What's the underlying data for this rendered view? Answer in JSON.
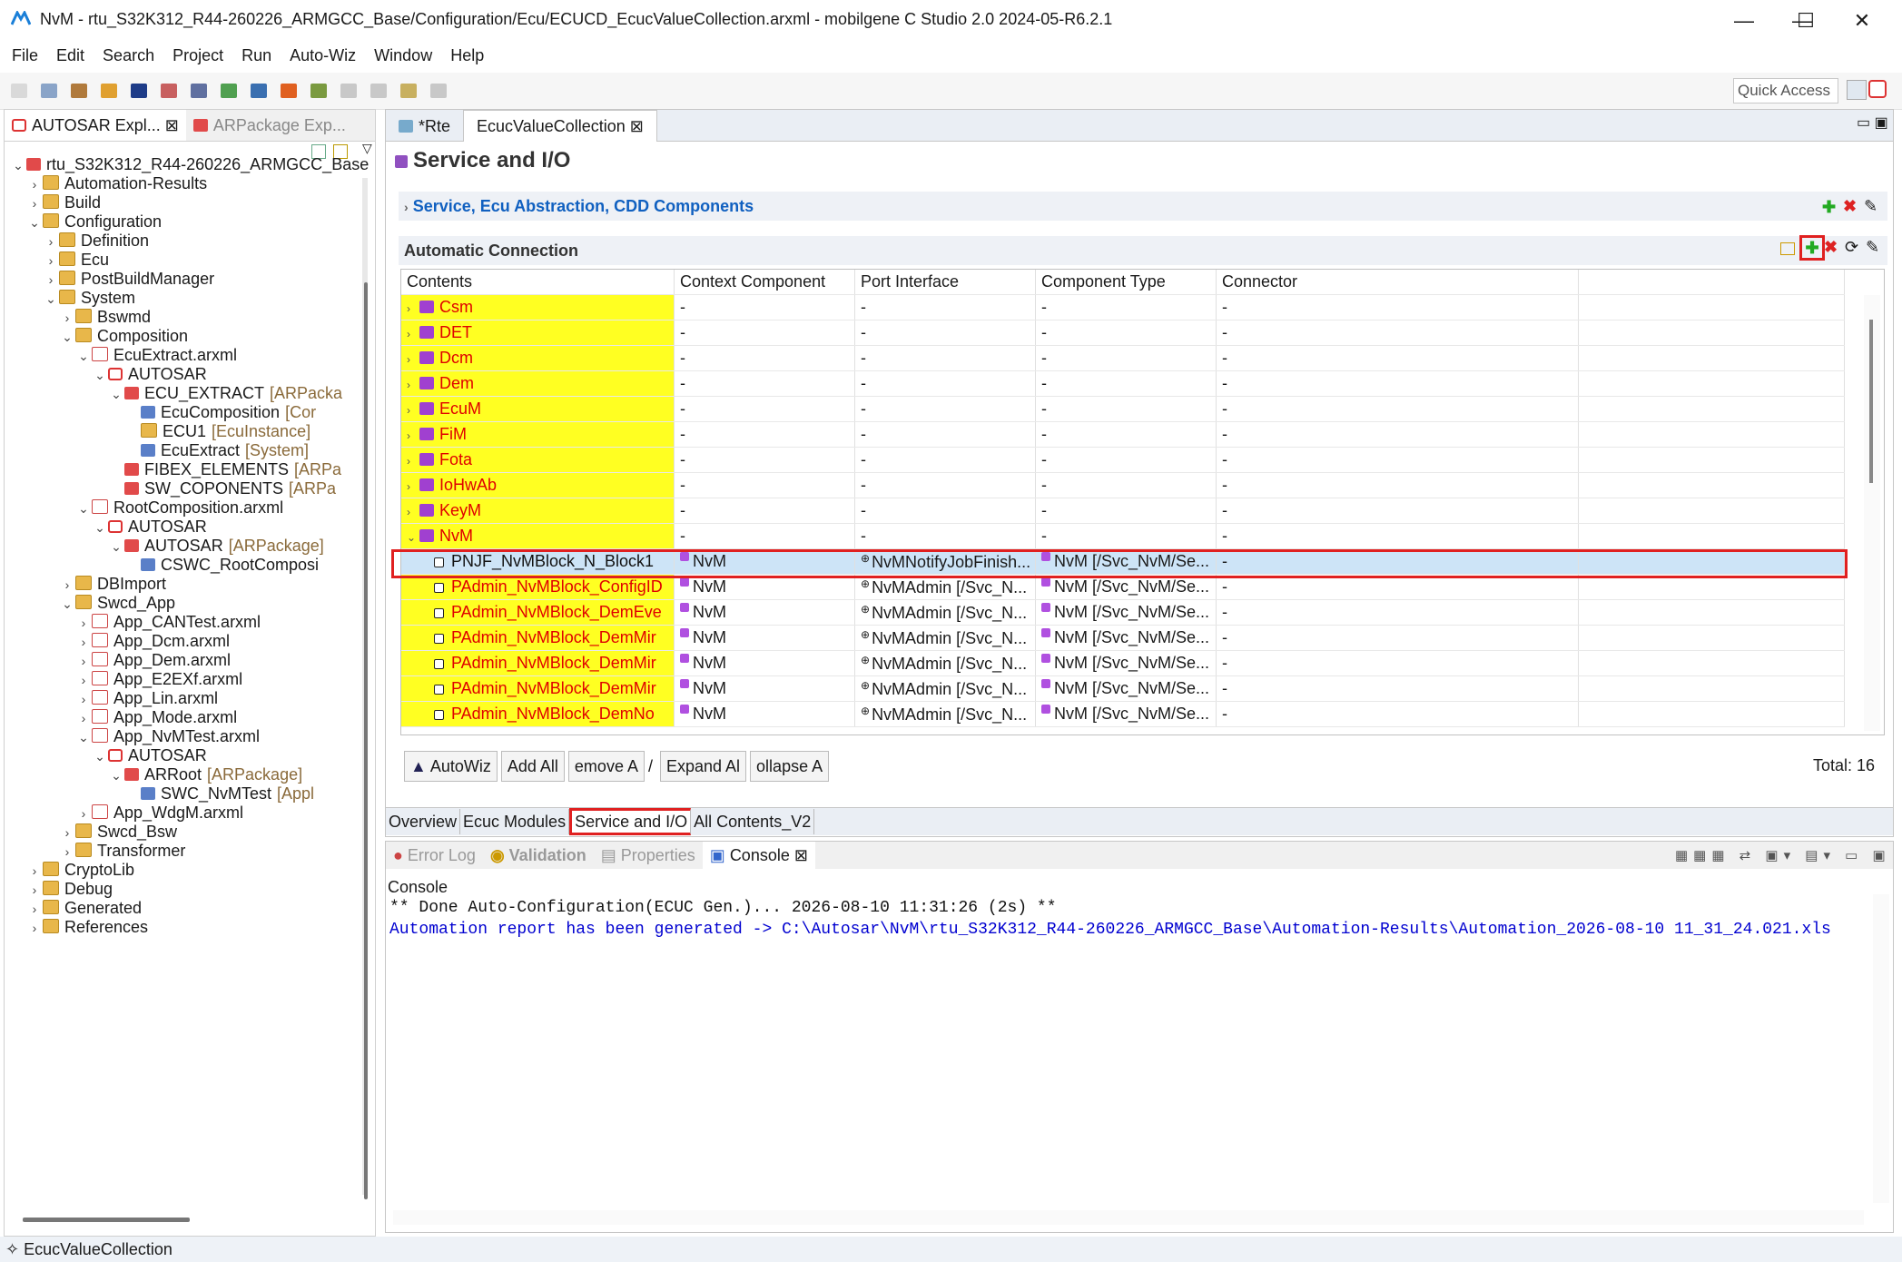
{
  "window": {
    "title": "NvM - rtu_S32K312_R44-260226_ARMGCC_Base/Configuration/Ecu/ECUCD_EcucValueCollection.arxml - mobilgene C Studio 2.0 2024-05-R6.2.1",
    "minimize": "—",
    "maximize": "☐",
    "close": "✕"
  },
  "menu": [
    "File",
    "Edit",
    "Search",
    "Project",
    "Run",
    "Auto-Wiz",
    "Window",
    "Help"
  ],
  "toolbar": {
    "quick_access": "Quick Access"
  },
  "left_panel": {
    "tabs": [
      "AUTOSAR Expl...",
      "ARPackage Exp..."
    ],
    "tree": [
      {
        "label": "rtu_S32K312_R44-260226_ARMGCC_Base",
        "suffix": "",
        "depth": 0,
        "tw": "v",
        "icon": "project"
      },
      {
        "label": "Automation-Results",
        "suffix": "",
        "depth": 1,
        "tw": ">",
        "icon": "folder"
      },
      {
        "label": "Build",
        "suffix": "",
        "depth": 1,
        "tw": ">",
        "icon": "folder"
      },
      {
        "label": "Configuration",
        "suffix": "",
        "depth": 1,
        "tw": "v",
        "icon": "folder-red"
      },
      {
        "label": "Definition",
        "suffix": "",
        "depth": 2,
        "tw": ">",
        "icon": "folder-red"
      },
      {
        "label": "Ecu",
        "suffix": "",
        "depth": 2,
        "tw": ">",
        "icon": "folder"
      },
      {
        "label": "PostBuildManager",
        "suffix": "",
        "depth": 2,
        "tw": ">",
        "icon": "folder"
      },
      {
        "label": "System",
        "suffix": "",
        "depth": 2,
        "tw": "v",
        "icon": "folder"
      },
      {
        "label": "Bswmd",
        "suffix": "",
        "depth": 3,
        "tw": ">",
        "icon": "folder"
      },
      {
        "label": "Composition",
        "suffix": "",
        "depth": 3,
        "tw": "v",
        "icon": "folder"
      },
      {
        "label": "EcuExtract.arxml",
        "suffix": "",
        "depth": 4,
        "tw": "v",
        "icon": "arxml"
      },
      {
        "label": "AUTOSAR",
        "suffix": "",
        "depth": 5,
        "tw": "v",
        "icon": "autosar"
      },
      {
        "label": "ECU_EXTRACT",
        "suffix": "[ARPacka",
        "depth": 6,
        "tw": "v",
        "icon": "pkg"
      },
      {
        "label": "EcuComposition",
        "suffix": "[Cor",
        "depth": 7,
        "tw": "",
        "icon": "comp"
      },
      {
        "label": "ECU1",
        "suffix": "[EcuInstance]",
        "depth": 7,
        "tw": "",
        "icon": "inst"
      },
      {
        "label": "EcuExtract",
        "suffix": "[System]",
        "depth": 7,
        "tw": "",
        "icon": "comp"
      },
      {
        "label": "FIBEX_ELEMENTS",
        "suffix": "[ARPa",
        "depth": 6,
        "tw": "",
        "icon": "pkg"
      },
      {
        "label": "SW_COPONENTS",
        "suffix": "[ARPa",
        "depth": 6,
        "tw": "",
        "icon": "pkg"
      },
      {
        "label": "RootComposition.arxml",
        "suffix": "",
        "depth": 4,
        "tw": "v",
        "icon": "arxml"
      },
      {
        "label": "AUTOSAR",
        "suffix": "",
        "depth": 5,
        "tw": "v",
        "icon": "autosar"
      },
      {
        "label": "AUTOSAR",
        "suffix": "[ARPackage]",
        "depth": 6,
        "tw": "v",
        "icon": "pkg"
      },
      {
        "label": "CSWC_RootComposi",
        "suffix": "",
        "depth": 7,
        "tw": "",
        "icon": "comp"
      },
      {
        "label": "DBImport",
        "suffix": "",
        "depth": 3,
        "tw": ">",
        "icon": "folder"
      },
      {
        "label": "Swcd_App",
        "suffix": "",
        "depth": 3,
        "tw": "v",
        "icon": "folder"
      },
      {
        "label": "App_CANTest.arxml",
        "suffix": "",
        "depth": 4,
        "tw": ">",
        "icon": "arxml"
      },
      {
        "label": "App_Dcm.arxml",
        "suffix": "",
        "depth": 4,
        "tw": ">",
        "icon": "arxml"
      },
      {
        "label": "App_Dem.arxml",
        "suffix": "",
        "depth": 4,
        "tw": ">",
        "icon": "arxml"
      },
      {
        "label": "App_E2EXf.arxml",
        "suffix": "",
        "depth": 4,
        "tw": ">",
        "icon": "arxml"
      },
      {
        "label": "App_Lin.arxml",
        "suffix": "",
        "depth": 4,
        "tw": ">",
        "icon": "arxml"
      },
      {
        "label": "App_Mode.arxml",
        "suffix": "",
        "depth": 4,
        "tw": ">",
        "icon": "arxml"
      },
      {
        "label": "App_NvMTest.arxml",
        "suffix": "",
        "depth": 4,
        "tw": "v",
        "icon": "arxml"
      },
      {
        "label": "AUTOSAR",
        "suffix": "",
        "depth": 5,
        "tw": "v",
        "icon": "autosar"
      },
      {
        "label": "ARRoot",
        "suffix": "[ARPackage]",
        "depth": 6,
        "tw": "v",
        "icon": "pkg"
      },
      {
        "label": "SWC_NvMTest",
        "suffix": "[Appl",
        "depth": 7,
        "tw": "",
        "icon": "swc"
      },
      {
        "label": "App_WdgM.arxml",
        "suffix": "",
        "depth": 4,
        "tw": ">",
        "icon": "arxml"
      },
      {
        "label": "Swcd_Bsw",
        "suffix": "",
        "depth": 3,
        "tw": ">",
        "icon": "folder"
      },
      {
        "label": "Transformer",
        "suffix": "",
        "depth": 3,
        "tw": ">",
        "icon": "folder"
      },
      {
        "label": "CryptoLib",
        "suffix": "",
        "depth": 1,
        "tw": ">",
        "icon": "folder"
      },
      {
        "label": "Debug",
        "suffix": "",
        "depth": 1,
        "tw": ">",
        "icon": "folder"
      },
      {
        "label": "Generated",
        "suffix": "",
        "depth": 1,
        "tw": ">",
        "icon": "folder-red"
      },
      {
        "label": "References",
        "suffix": "",
        "depth": 1,
        "tw": ">",
        "icon": "folder"
      }
    ]
  },
  "editor": {
    "tabs": [
      "*Rte",
      "EcucValueCollection"
    ],
    "page_title": "Service and I/O",
    "section1": "Service, Ecu Abstraction, CDD Components",
    "section2": "Automatic Connection",
    "columns": [
      "Contents",
      "Context Component",
      "Port Interface",
      "Component Type",
      "Connector"
    ],
    "rows": [
      {
        "c": "Csm",
        "ctx": "-",
        "port": "-",
        "type": "-",
        "conn": "-",
        "kind": "module"
      },
      {
        "c": "DET",
        "ctx": "-",
        "port": "-",
        "type": "-",
        "conn": "-",
        "kind": "module"
      },
      {
        "c": "Dcm",
        "ctx": "-",
        "port": "-",
        "type": "-",
        "conn": "-",
        "kind": "module"
      },
      {
        "c": "Dem",
        "ctx": "-",
        "port": "-",
        "type": "-",
        "conn": "-",
        "kind": "module"
      },
      {
        "c": "EcuM",
        "ctx": "-",
        "port": "-",
        "type": "-",
        "conn": "-",
        "kind": "module"
      },
      {
        "c": "FiM",
        "ctx": "-",
        "port": "-",
        "type": "-",
        "conn": "-",
        "kind": "module"
      },
      {
        "c": "Fota",
        "ctx": "-",
        "port": "-",
        "type": "-",
        "conn": "-",
        "kind": "module"
      },
      {
        "c": "IoHwAb",
        "ctx": "-",
        "port": "-",
        "type": "-",
        "conn": "-",
        "kind": "module"
      },
      {
        "c": "KeyM",
        "ctx": "-",
        "port": "-",
        "type": "-",
        "conn": "-",
        "kind": "module"
      },
      {
        "c": "NvM",
        "ctx": "-",
        "port": "-",
        "type": "-",
        "conn": "-",
        "kind": "module-open"
      },
      {
        "c": "PNJF_NvMBlock_N_Block1",
        "ctx": "NvM",
        "port": "NvMNotifyJobFinish...",
        "type": "NvM [/Svc_NvM/Se...",
        "conn": "-",
        "kind": "selected"
      },
      {
        "c": "PAdmin_NvMBlock_ConfigID",
        "ctx": "NvM",
        "port": "NvMAdmin [/Svc_N...",
        "type": "NvM [/Svc_NvM/Se...",
        "conn": "-",
        "kind": "port"
      },
      {
        "c": "PAdmin_NvMBlock_DemEve",
        "ctx": "NvM",
        "port": "NvMAdmin [/Svc_N...",
        "type": "NvM [/Svc_NvM/Se...",
        "conn": "-",
        "kind": "port"
      },
      {
        "c": "PAdmin_NvMBlock_DemMir",
        "ctx": "NvM",
        "port": "NvMAdmin [/Svc_N...",
        "type": "NvM [/Svc_NvM/Se...",
        "conn": "-",
        "kind": "port"
      },
      {
        "c": "PAdmin_NvMBlock_DemMir",
        "ctx": "NvM",
        "port": "NvMAdmin [/Svc_N...",
        "type": "NvM [/Svc_NvM/Se...",
        "conn": "-",
        "kind": "port"
      },
      {
        "c": "PAdmin_NvMBlock_DemMir",
        "ctx": "NvM",
        "port": "NvMAdmin [/Svc_N...",
        "type": "NvM [/Svc_NvM/Se...",
        "conn": "-",
        "kind": "port"
      },
      {
        "c": "PAdmin_NvMBlock_DemNo",
        "ctx": "NvM",
        "port": "NvMAdmin [/Svc_N...",
        "type": "NvM [/Svc_NvM/Se...",
        "conn": "-",
        "kind": "port"
      }
    ],
    "buttons": [
      "AutoWiz",
      "Add All",
      "emove A",
      "/",
      "Expand Al",
      "ollapse A"
    ],
    "total": "Total: 16",
    "bottom_tabs": [
      "Overview",
      "Ecuc Modules",
      "Service and I/O",
      "All Contents_V2"
    ]
  },
  "console": {
    "tabs": [
      "Error Log",
      "Validation",
      "Properties",
      "Console"
    ],
    "header": "Console",
    "line1": "** Done Auto-Configuration(ECUC Gen.)... 2026-08-10 11:31:26 (2s) **",
    "line2": "Automation report has been generated -> C:\\Autosar\\NvM\\rtu_S32K312_R44-260226_ARMGCC_Base\\Automation-Results\\Automation_2026-08-10 11_31_24.021.xls"
  },
  "status": {
    "text": "EcucValueCollection"
  },
  "colors": {
    "highlight_yellow": "#ffff22",
    "module_red": "#e00000",
    "link_blue": "#1060c0",
    "box_red": "#e02020",
    "console_blue": "#0000d0"
  }
}
